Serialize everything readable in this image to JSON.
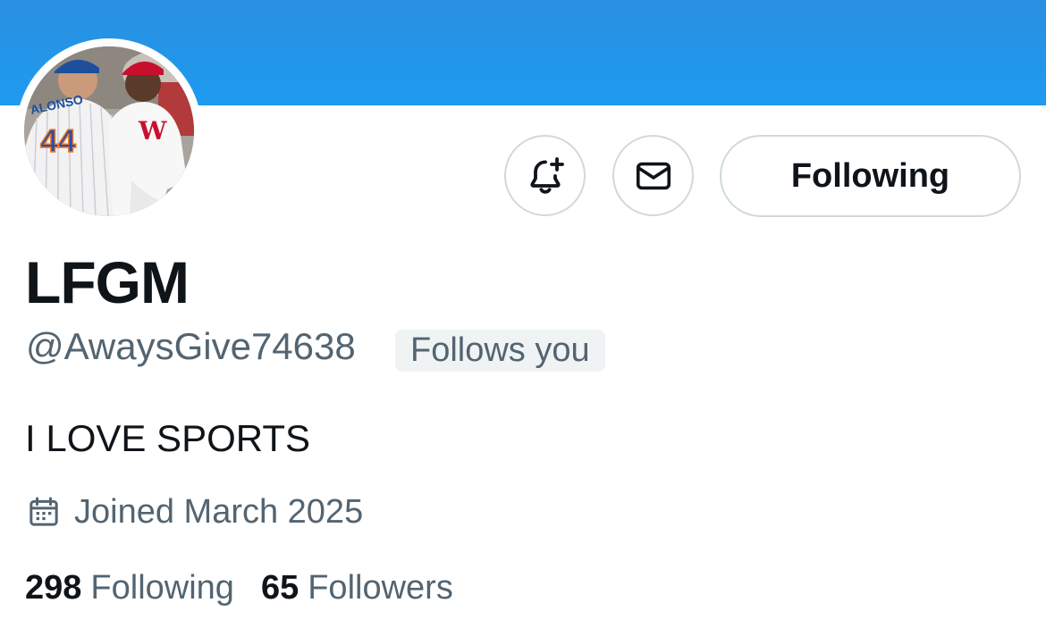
{
  "profile": {
    "display_name": "LFGM",
    "handle": "@AwaysGive74638",
    "follows_you_badge": "Follows you",
    "bio": "I LOVE SPORTS",
    "joined": "Joined March 2025",
    "following_count": "298",
    "following_label": "Following",
    "followers_count": "65",
    "followers_label": "Followers",
    "avatar_jersey_text": "ALONSO",
    "avatar_jersey_number": "44"
  },
  "actions": {
    "notify_icon": "bell-plus-icon",
    "message_icon": "envelope-icon",
    "follow_button_label": "Following"
  },
  "colors": {
    "banner": "#1d9bf0",
    "primary_text": "#0f1419",
    "secondary_text": "#536471",
    "border": "#cfd9de",
    "badge_bg": "#eff3f4"
  }
}
